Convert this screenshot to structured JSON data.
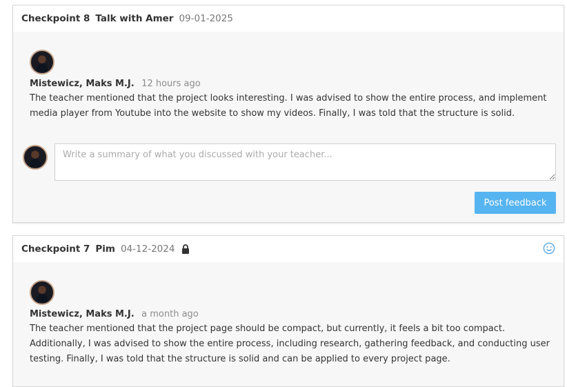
{
  "checkpoints": [
    {
      "label": "Checkpoint 8",
      "title": "Talk with Amer",
      "date": "09-01-2025",
      "feedback": {
        "author": "Mistewicz, Maks M.J.",
        "time": "12 hours ago",
        "text": "The teacher mentioned that the project looks interesting. I was advised to show the entire process, and implement media player from Youtube into the website to show my videos. Finally, I was told that the structure is solid."
      },
      "composer": {
        "placeholder": "Write a summary of what you discussed with your teacher...",
        "post_label": "Post feedback"
      }
    },
    {
      "label": "Checkpoint 7",
      "title": "Pim",
      "date": "04-12-2024",
      "icons": [
        "lock-icon",
        "smile-icon"
      ],
      "feedback": {
        "author": "Mistewicz, Maks M.J.",
        "time": "a month ago",
        "text": "The teacher mentioned that the project page should be compact, but currently, it feels a bit too compact. Additionally, I was advised to show the entire process, including research, gathering feedback, and conducting user testing. Finally, I was told that the structure is solid and can be applied to every project page."
      }
    }
  ],
  "colors": {
    "accent": "#56b4f0",
    "card_body": "#f7f7f7",
    "muted_text": "#8c8c8c"
  }
}
